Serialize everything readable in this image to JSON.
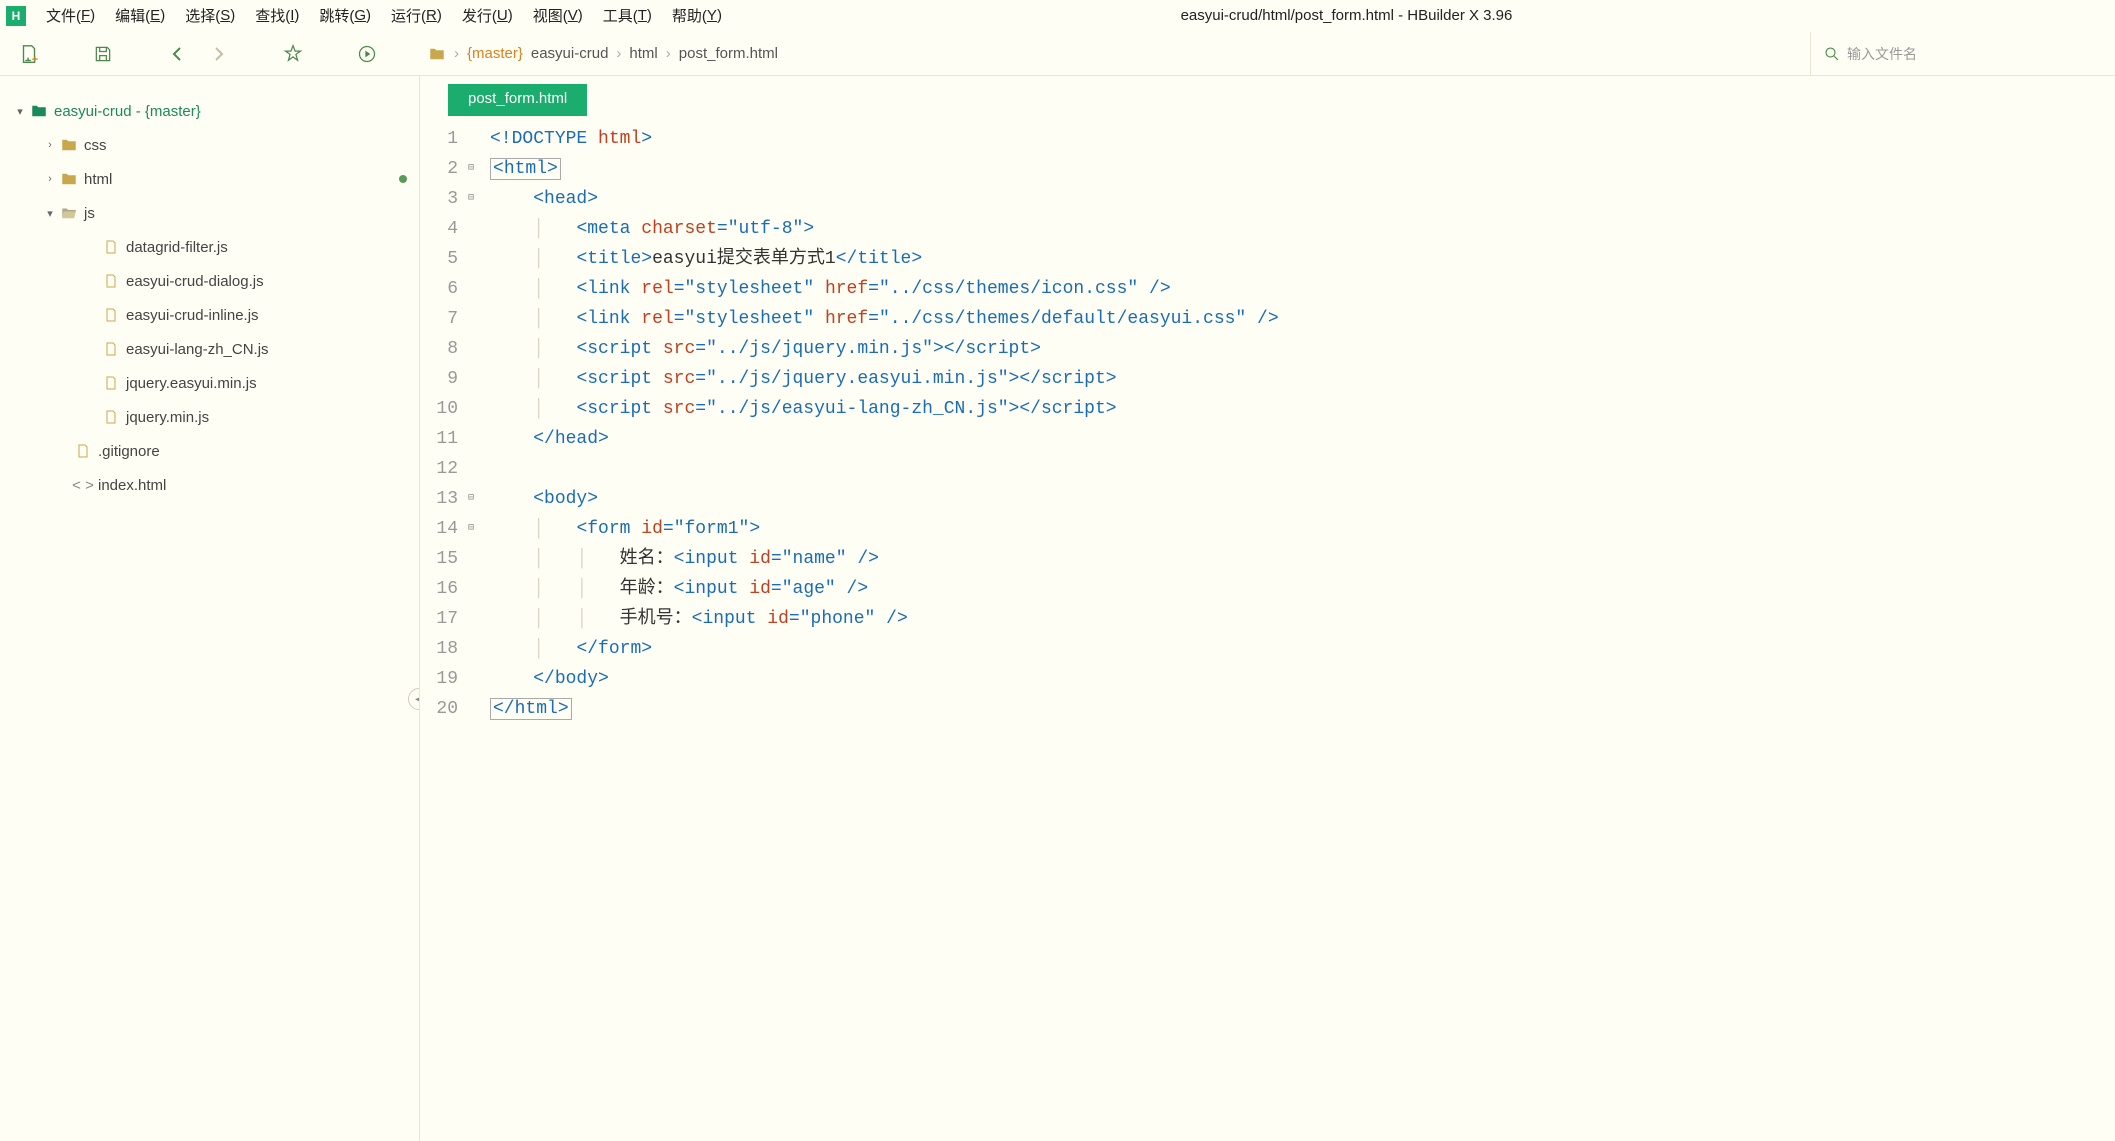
{
  "window": {
    "title": "easyui-crud/html/post_form.html - HBuilder X 3.96"
  },
  "menubar": {
    "items": [
      {
        "label": "文件(F)",
        "key": "F"
      },
      {
        "label": "编辑(E)",
        "key": "E"
      },
      {
        "label": "选择(S)",
        "key": "S"
      },
      {
        "label": "查找(I)",
        "key": "I"
      },
      {
        "label": "跳转(G)",
        "key": "G"
      },
      {
        "label": "运行(R)",
        "key": "R"
      },
      {
        "label": "发行(U)",
        "key": "U"
      },
      {
        "label": "视图(V)",
        "key": "V"
      },
      {
        "label": "工具(T)",
        "key": "T"
      },
      {
        "label": "帮助(Y)",
        "key": "Y"
      }
    ]
  },
  "toolbar": {
    "search_placeholder": "输入文件名"
  },
  "breadcrumb": {
    "branch": "{master}",
    "parts": [
      "easyui-crud",
      "html",
      "post_form.html"
    ]
  },
  "sidebar": {
    "root": {
      "name": "easyui-crud",
      "branch": " - {master}"
    },
    "folders": [
      {
        "name": "css",
        "expanded": false,
        "modified": false
      },
      {
        "name": "html",
        "expanded": false,
        "modified": true
      },
      {
        "name": "js",
        "expanded": true,
        "modified": false
      }
    ],
    "js_files": [
      "datagrid-filter.js",
      "easyui-crud-dialog.js",
      "easyui-crud-inline.js",
      "easyui-lang-zh_CN.js",
      "jquery.easyui.min.js",
      "jquery.min.js"
    ],
    "root_files": [
      {
        "name": ".gitignore",
        "kind": "gitignore"
      },
      {
        "name": "index.html",
        "kind": "html"
      }
    ]
  },
  "tab": {
    "active": "post_form.html"
  },
  "code": {
    "lines": [
      {
        "n": 1,
        "fold": "",
        "html": "<span class='tok-punct'>&lt;!</span><span class='tok-doctype1'>DOCTYPE</span> <span class='tok-doctype2'>html</span><span class='tok-punct'>&gt;</span>"
      },
      {
        "n": 2,
        "fold": "⊟",
        "html": "<span class='boxed'><span class='tok-punct'>&lt;</span><span class='tok-tag'>html</span><span class='tok-punct'>&gt;</span></span>"
      },
      {
        "n": 3,
        "fold": "⊟",
        "html": "    <span class='tok-punct'>&lt;</span><span class='tok-tag'>head</span><span class='tok-punct'>&gt;</span>"
      },
      {
        "n": 4,
        "fold": "",
        "html": "    <span class='guide'>│</span>   <span class='tok-punct'>&lt;</span><span class='tok-tag'>meta</span> <span class='tok-attr'>charset</span><span class='tok-punct'>=</span><span class='tok-str'>\"utf-8\"</span><span class='tok-punct'>&gt;</span>"
      },
      {
        "n": 5,
        "fold": "",
        "html": "    <span class='guide'>│</span>   <span class='tok-punct'>&lt;</span><span class='tok-tag'>title</span><span class='tok-punct'>&gt;</span><span class='tok-text'>easyui提交表单方式1</span><span class='tok-punct'>&lt;/</span><span class='tok-tag'>title</span><span class='tok-punct'>&gt;</span>"
      },
      {
        "n": 6,
        "fold": "",
        "html": "    <span class='guide'>│</span>   <span class='tok-punct'>&lt;</span><span class='tok-tag'>link</span> <span class='tok-attr'>rel</span><span class='tok-punct'>=</span><span class='tok-str'>\"stylesheet\"</span> <span class='tok-attr'>href</span><span class='tok-punct'>=</span><span class='tok-str'>\"../css/themes/icon.css\"</span> <span class='tok-punct'>/&gt;</span>"
      },
      {
        "n": 7,
        "fold": "",
        "html": "    <span class='guide'>│</span>   <span class='tok-punct'>&lt;</span><span class='tok-tag'>link</span> <span class='tok-attr'>rel</span><span class='tok-punct'>=</span><span class='tok-str'>\"stylesheet\"</span> <span class='tok-attr'>href</span><span class='tok-punct'>=</span><span class='tok-str'>\"../css/themes/default/easyui.css\"</span> <span class='tok-punct'>/&gt;</span>"
      },
      {
        "n": 8,
        "fold": "",
        "html": "    <span class='guide'>│</span>   <span class='tok-punct'>&lt;</span><span class='tok-tag'>script</span> <span class='tok-attr'>src</span><span class='tok-punct'>=</span><span class='tok-str'>\"../js/jquery.min.js\"</span><span class='tok-punct'>&gt;&lt;/</span><span class='tok-tag'>script</span><span class='tok-punct'>&gt;</span>"
      },
      {
        "n": 9,
        "fold": "",
        "html": "    <span class='guide'>│</span>   <span class='tok-punct'>&lt;</span><span class='tok-tag'>script</span> <span class='tok-attr'>src</span><span class='tok-punct'>=</span><span class='tok-str'>\"../js/jquery.easyui.min.js\"</span><span class='tok-punct'>&gt;&lt;/</span><span class='tok-tag'>script</span><span class='tok-punct'>&gt;</span>"
      },
      {
        "n": 10,
        "fold": "",
        "html": "    <span class='guide'>│</span>   <span class='tok-punct'>&lt;</span><span class='tok-tag'>script</span> <span class='tok-attr'>src</span><span class='tok-punct'>=</span><span class='tok-str'>\"../js/easyui-lang-zh_CN.js\"</span><span class='tok-punct'>&gt;&lt;/</span><span class='tok-tag'>script</span><span class='tok-punct'>&gt;</span>"
      },
      {
        "n": 11,
        "fold": "",
        "html": "    <span class='tok-punct'>&lt;/</span><span class='tok-tag'>head</span><span class='tok-punct'>&gt;</span>"
      },
      {
        "n": 12,
        "fold": "",
        "html": ""
      },
      {
        "n": 13,
        "fold": "⊟",
        "html": "    <span class='tok-punct'>&lt;</span><span class='tok-tag'>body</span><span class='tok-punct'>&gt;</span>"
      },
      {
        "n": 14,
        "fold": "⊟",
        "html": "    <span class='guide'>│</span>   <span class='tok-punct'>&lt;</span><span class='tok-tag'>form</span> <span class='tok-attr'>id</span><span class='tok-punct'>=</span><span class='tok-str'>\"form1\"</span><span class='tok-punct'>&gt;</span>"
      },
      {
        "n": 15,
        "fold": "",
        "html": "    <span class='guide'>│</span>   <span class='guide'>│</span>   <span class='tok-text'>姓名：</span><span class='tok-punct'>&lt;</span><span class='tok-tag'>input</span> <span class='tok-attr'>id</span><span class='tok-punct'>=</span><span class='tok-str'>\"name\"</span> <span class='tok-punct'>/&gt;</span>"
      },
      {
        "n": 16,
        "fold": "",
        "html": "    <span class='guide'>│</span>   <span class='guide'>│</span>   <span class='tok-text'>年龄：</span><span class='tok-punct'>&lt;</span><span class='tok-tag'>input</span> <span class='tok-attr'>id</span><span class='tok-punct'>=</span><span class='tok-str'>\"age\"</span> <span class='tok-punct'>/&gt;</span>"
      },
      {
        "n": 17,
        "fold": "",
        "html": "    <span class='guide'>│</span>   <span class='guide'>│</span>   <span class='tok-text'>手机号：</span><span class='tok-punct'>&lt;</span><span class='tok-tag'>input</span> <span class='tok-attr'>id</span><span class='tok-punct'>=</span><span class='tok-str'>\"phone\"</span> <span class='tok-punct'>/&gt;</span>"
      },
      {
        "n": 18,
        "fold": "",
        "html": "    <span class='guide'>│</span>   <span class='tok-punct'>&lt;/</span><span class='tok-tag'>form</span><span class='tok-punct'>&gt;</span>"
      },
      {
        "n": 19,
        "fold": "",
        "html": "    <span class='tok-punct'>&lt;/</span><span class='tok-tag'>body</span><span class='tok-punct'>&gt;</span>"
      },
      {
        "n": 20,
        "fold": "",
        "html": "<span class='boxed'><span class='tok-punct'>&lt;/</span><span class='tok-tag'>html</span><span class='tok-punct'>&gt;</span></span>"
      }
    ]
  }
}
